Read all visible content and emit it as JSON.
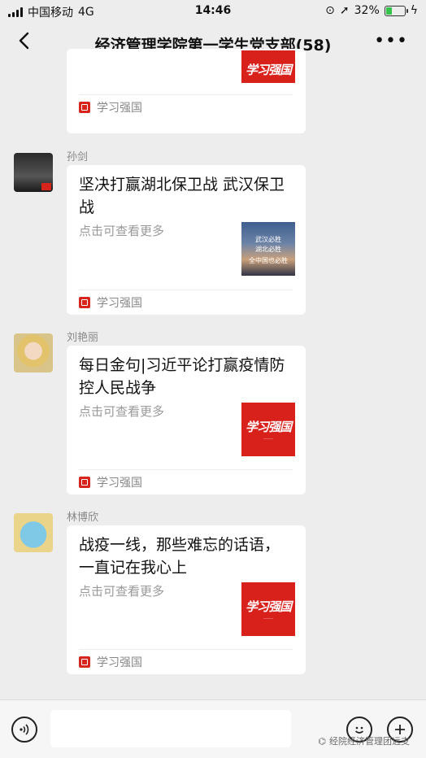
{
  "status_bar": {
    "carrier": "中国移动",
    "network": "4G",
    "time": "14:46",
    "battery": "32%"
  },
  "nav": {
    "title": "经济管理学院第一学生党支部(58)"
  },
  "messages": [
    {
      "sender": "",
      "title": "",
      "subtitle": "",
      "source": "学习强国",
      "thumb_text": "学习强国"
    },
    {
      "sender": "孙剑",
      "title": "坚决打赢湖北保卫战 武汉保卫战",
      "subtitle": "点击可查看更多",
      "source": "学习强国",
      "thumb_lines": [
        "武汉必胜",
        "湖北必胜",
        "全中国也必胜"
      ]
    },
    {
      "sender": "刘艳丽",
      "title": "每日金句|习近平论打赢疫情防控人民战争",
      "subtitle": "点击可查看更多",
      "source": "学习强国",
      "thumb_text": "学习强国"
    },
    {
      "sender": "林博欣",
      "title": "战疫一线，那些难忘的话语，一直记在我心上",
      "subtitle": "点击可查看更多",
      "source": "学习强国",
      "thumb_text": "学习强国"
    }
  ],
  "watermark": "经院经济管理团远支"
}
